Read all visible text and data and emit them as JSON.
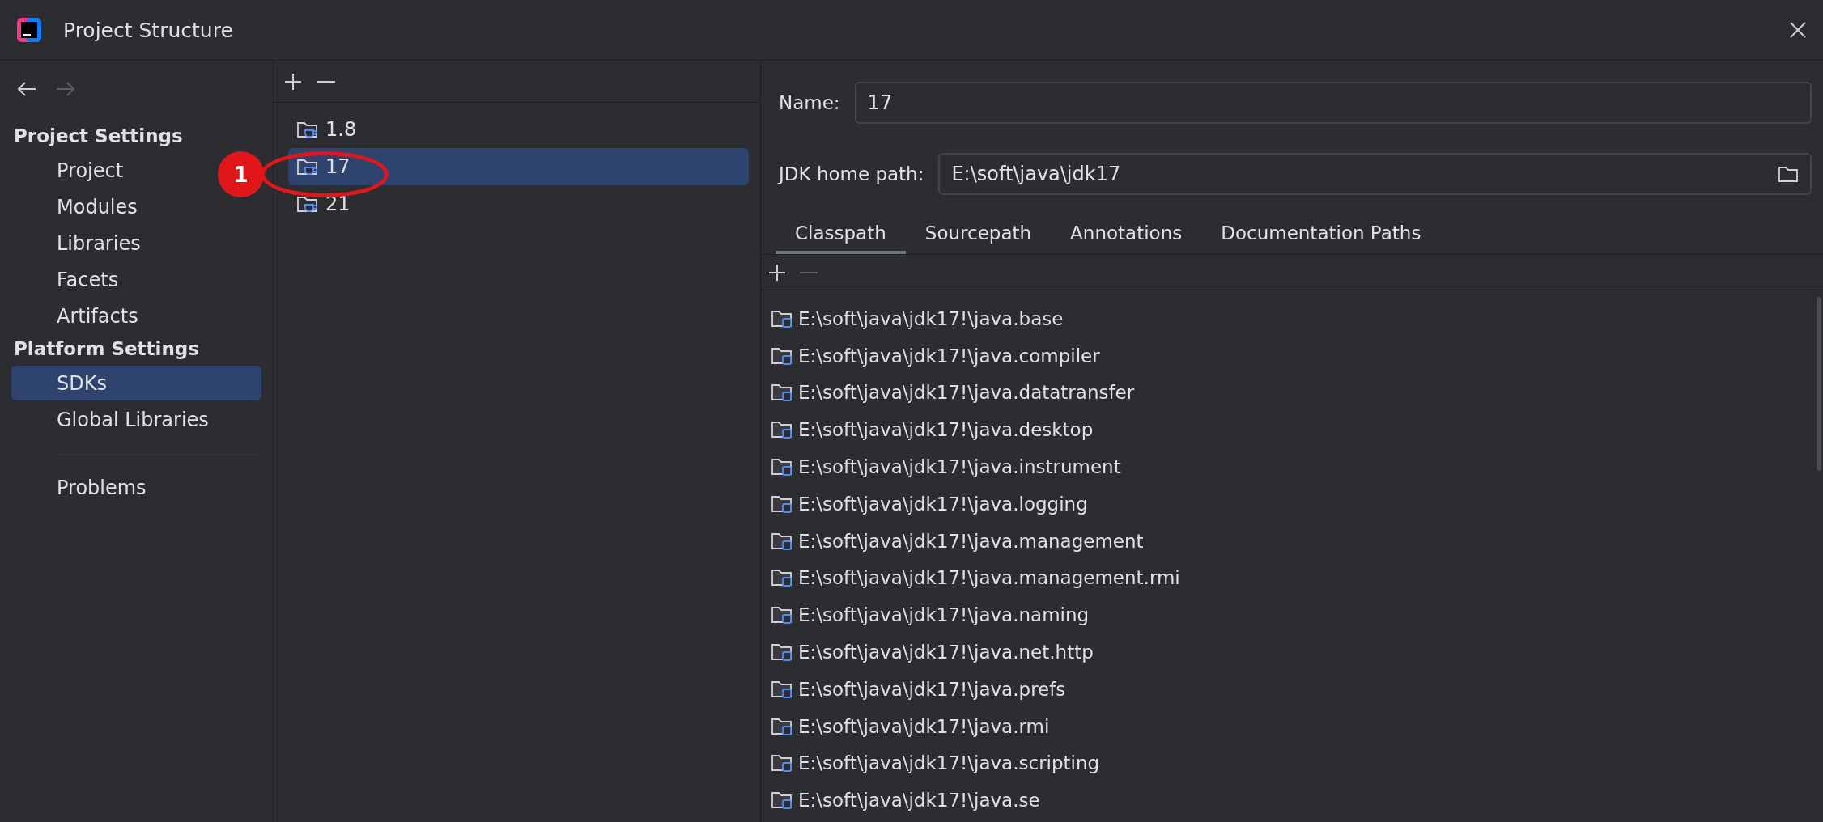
{
  "window": {
    "title": "Project Structure"
  },
  "navigation": {
    "back_enabled": true,
    "forward_enabled": false
  },
  "sidebar": {
    "sections": [
      {
        "title": "Project Settings",
        "items": [
          {
            "label": "Project",
            "selected": false
          },
          {
            "label": "Modules",
            "selected": false
          },
          {
            "label": "Libraries",
            "selected": false
          },
          {
            "label": "Facets",
            "selected": false
          },
          {
            "label": "Artifacts",
            "selected": false
          }
        ]
      },
      {
        "title": "Platform Settings",
        "items": [
          {
            "label": "SDKs",
            "selected": true
          },
          {
            "label": "Global Libraries",
            "selected": false
          }
        ]
      }
    ],
    "footer_items": [
      {
        "label": "Problems",
        "selected": false
      }
    ]
  },
  "sdk_list": {
    "add_enabled": true,
    "remove_enabled": true,
    "annotation": "1",
    "items": [
      {
        "label": "1.8",
        "selected": false
      },
      {
        "label": "17",
        "selected": true
      },
      {
        "label": "21",
        "selected": false
      }
    ]
  },
  "details": {
    "name_label": "Name:",
    "name_value": "17",
    "home_label": "JDK home path:",
    "home_value": "E:\\soft\\java\\jdk17",
    "tabs": [
      {
        "label": "Classpath",
        "selected": true
      },
      {
        "label": "Sourcepath",
        "selected": false
      },
      {
        "label": "Annotations",
        "selected": false
      },
      {
        "label": "Documentation Paths",
        "selected": false
      }
    ],
    "add_enabled": true,
    "remove_enabled": false,
    "paths": [
      "E:\\soft\\java\\jdk17!\\java.base",
      "E:\\soft\\java\\jdk17!\\java.compiler",
      "E:\\soft\\java\\jdk17!\\java.datatransfer",
      "E:\\soft\\java\\jdk17!\\java.desktop",
      "E:\\soft\\java\\jdk17!\\java.instrument",
      "E:\\soft\\java\\jdk17!\\java.logging",
      "E:\\soft\\java\\jdk17!\\java.management",
      "E:\\soft\\java\\jdk17!\\java.management.rmi",
      "E:\\soft\\java\\jdk17!\\java.naming",
      "E:\\soft\\java\\jdk17!\\java.net.http",
      "E:\\soft\\java\\jdk17!\\java.prefs",
      "E:\\soft\\java\\jdk17!\\java.rmi",
      "E:\\soft\\java\\jdk17!\\java.scripting",
      "E:\\soft\\java\\jdk17!\\java.se"
    ]
  }
}
